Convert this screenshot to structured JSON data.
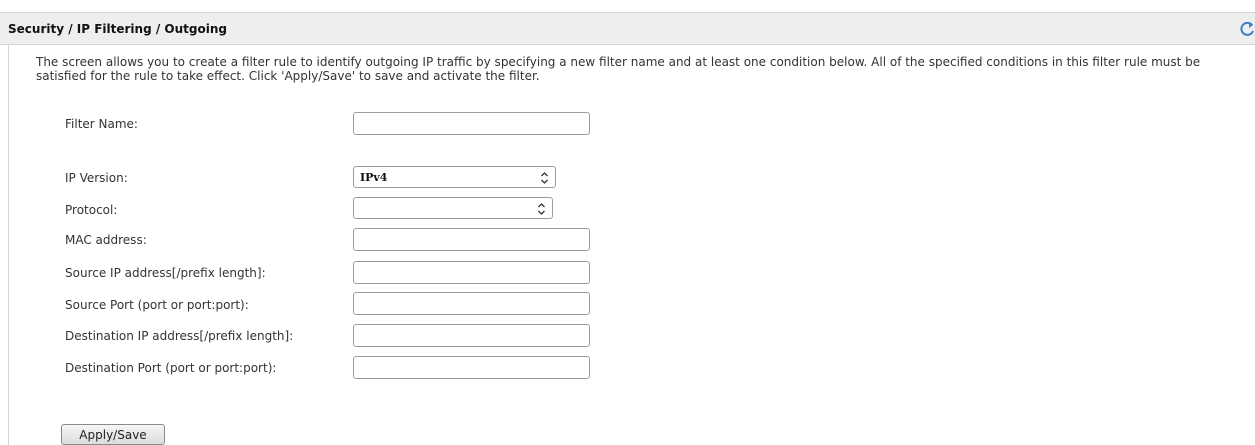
{
  "header": {
    "title": "Security / IP Filtering / Outgoing",
    "refresh_icon": "refresh-icon"
  },
  "description": "The screen allows you to create a filter rule to identify outgoing IP traffic by specifying a new filter name and at least one condition below. All of the specified conditions in this filter rule must be satisfied for the rule to take effect. Click 'Apply/Save' to save and activate the filter.",
  "form": {
    "filter_name": {
      "label": "Filter Name:",
      "value": ""
    },
    "ip_version": {
      "label": "IP Version:",
      "selected": "IPv4"
    },
    "protocol": {
      "label": "Protocol:",
      "selected": ""
    },
    "mac_address": {
      "label": "MAC address:",
      "value": ""
    },
    "source_ip": {
      "label": "Source IP address[/prefix length]:",
      "value": ""
    },
    "source_port": {
      "label": "Source Port (port or port:port):",
      "value": ""
    },
    "dest_ip": {
      "label": "Destination IP address[/prefix length]:",
      "value": ""
    },
    "dest_port": {
      "label": "Destination Port (port or port:port):",
      "value": ""
    }
  },
  "actions": {
    "apply_save_label": "Apply/Save"
  },
  "colors": {
    "header_bg": "#eeeeee",
    "border": "#d4d4d4",
    "refresh_icon": "#3b7fc4"
  }
}
